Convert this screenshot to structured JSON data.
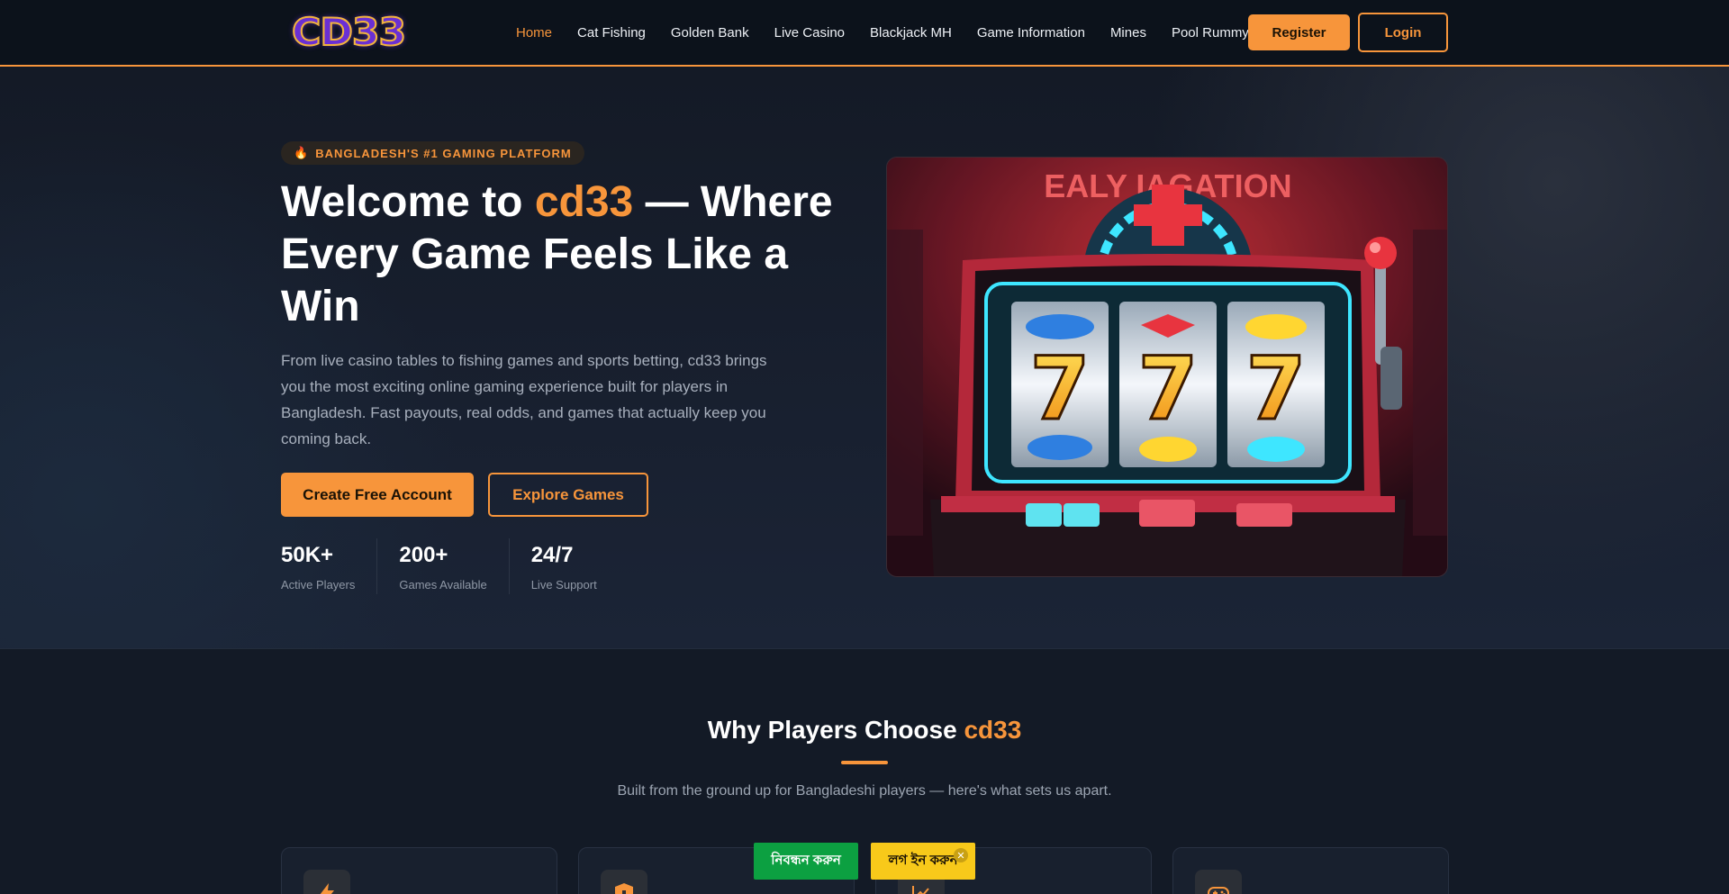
{
  "header": {
    "logo_text": "CD33",
    "nav": [
      "Home",
      "Cat Fishing",
      "Golden Bank",
      "Live Casino",
      "Blackjack MH",
      "Game Information",
      "Mines",
      "Pool Rummy"
    ],
    "register_label": "Register",
    "login_label": "Login",
    "accent_color": "#f7953b"
  },
  "hero": {
    "badge_icon": "fire-icon",
    "badge": "BANGLADESH'S #1 GAMING PLATFORM",
    "title_pre": "Welcome to ",
    "title_accent": "cd33",
    "title_post": " — Where Every Game Feels Like a Win",
    "description": "From live casino tables to fishing games and sports betting, cd33 brings you the most exciting online gaming experience built for players in Bangladesh. Fast payouts, real odds, and games that actually keep you coming back.",
    "cta_primary": "Create Free Account",
    "cta_secondary": "Explore Games",
    "stats": [
      {
        "value": "50K+",
        "label": "Active Players"
      },
      {
        "value": "200+",
        "label": "Games Available"
      },
      {
        "value": "24/7",
        "label": "Live Support"
      }
    ],
    "image": {
      "sign_text": "EALY IAGATION",
      "reel_symbol": "7"
    }
  },
  "why": {
    "title_pre": "Why Players Choose ",
    "title_accent": "cd33",
    "subtitle": "Built from the ground up for Bangladeshi players — here's what sets us apart.",
    "card_icons": [
      "lightning-icon",
      "shield-icon",
      "chart-icon",
      "gamepad-icon"
    ]
  },
  "floating": {
    "register_label": "নিবন্ধন করুন",
    "login_label": "লগ ইন করুন",
    "close_icon": "close-icon"
  }
}
